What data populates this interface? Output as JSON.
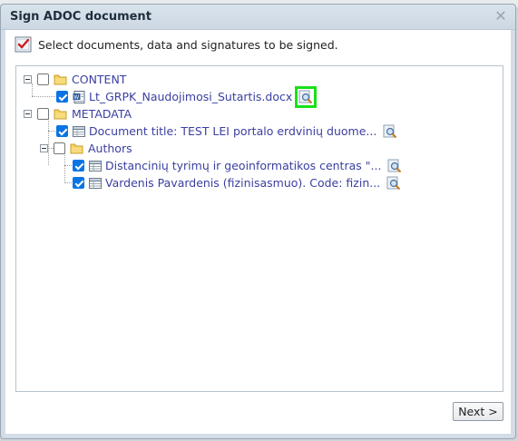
{
  "dialog": {
    "title": "Sign ADOC document",
    "close_icon": "close-icon",
    "instruction": "Select documents, data and signatures to be signed.",
    "next_label": "Next >"
  },
  "tree": {
    "content": {
      "label": "CONTENT",
      "checked": false,
      "expanded": true,
      "file": {
        "label": "Lt_GRPK_Naudojimosi_Sutartis.docx",
        "checked": true,
        "icon": "word-document-icon"
      }
    },
    "metadata": {
      "label": "METADATA",
      "checked": false,
      "expanded": true,
      "document_title": {
        "label": "Document title: TEST LEI portalo erdvinių duome...",
        "checked": true
      },
      "authors": {
        "label": "Authors",
        "checked": false,
        "expanded": true,
        "items": [
          {
            "label": "Distancinių tyrimų ir geoinformatikos centras \"...",
            "checked": true
          },
          {
            "label": "Vardenis Pavardenis (fizinisasmuo). Code: fizin...",
            "checked": true
          }
        ]
      }
    }
  },
  "colors": {
    "link_text": "#3b3fa0",
    "checkbox_checked": "#0b74e5",
    "highlight": "#19e019",
    "dialog_frame": "#d3dde7"
  }
}
